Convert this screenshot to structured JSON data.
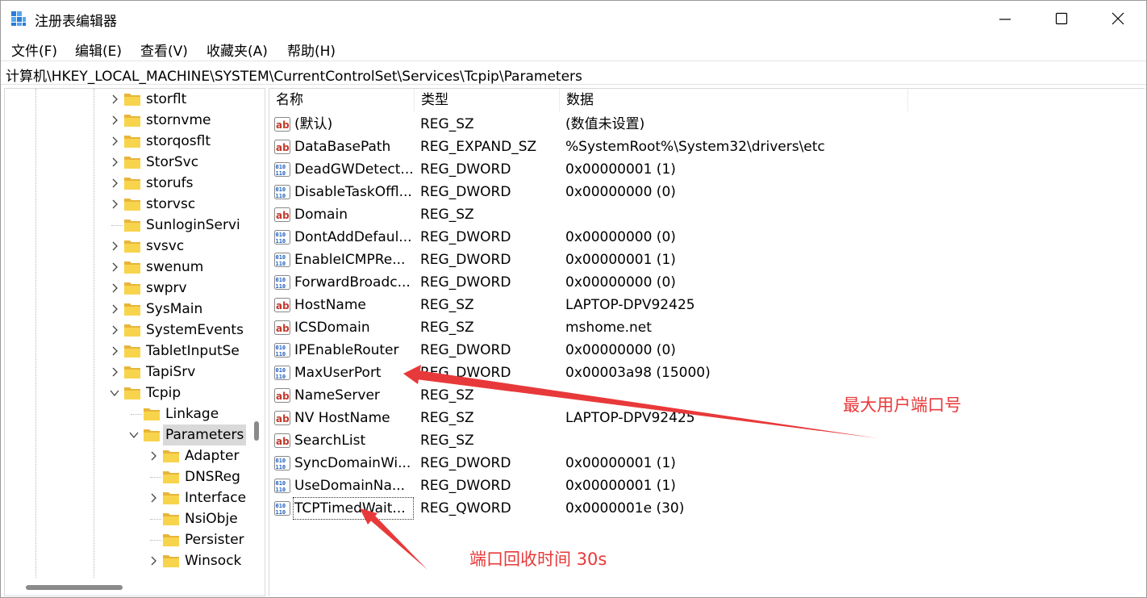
{
  "window": {
    "title": "注册表编辑器"
  },
  "menu": [
    {
      "label": "文件(F)"
    },
    {
      "label": "编辑(E)"
    },
    {
      "label": "查看(V)"
    },
    {
      "label": "收藏夹(A)"
    },
    {
      "label": "帮助(H)"
    }
  ],
  "address": "计算机\\HKEY_LOCAL_MACHINE\\SYSTEM\\CurrentControlSet\\Services\\Tcpip\\Parameters",
  "tree": {
    "items": [
      {
        "label": "storflt",
        "expander": "collapsed",
        "depth": 0
      },
      {
        "label": "stornvme",
        "expander": "collapsed",
        "depth": 0
      },
      {
        "label": "storqosflt",
        "expander": "collapsed",
        "depth": 0
      },
      {
        "label": "StorSvc",
        "expander": "collapsed",
        "depth": 0
      },
      {
        "label": "storufs",
        "expander": "collapsed",
        "depth": 0
      },
      {
        "label": "storvsc",
        "expander": "collapsed",
        "depth": 0
      },
      {
        "label": "SunloginServi",
        "expander": "none",
        "depth": 0
      },
      {
        "label": "svsvc",
        "expander": "collapsed",
        "depth": 0
      },
      {
        "label": "swenum",
        "expander": "collapsed",
        "depth": 0
      },
      {
        "label": "swprv",
        "expander": "collapsed",
        "depth": 0
      },
      {
        "label": "SysMain",
        "expander": "collapsed",
        "depth": 0
      },
      {
        "label": "SystemEvents",
        "expander": "collapsed",
        "depth": 0
      },
      {
        "label": "TabletInputSe",
        "expander": "collapsed",
        "depth": 0
      },
      {
        "label": "TapiSrv",
        "expander": "collapsed",
        "depth": 0
      },
      {
        "label": "Tcpip",
        "expander": "expanded",
        "depth": 0
      },
      {
        "label": "Linkage",
        "expander": "none",
        "depth": 1
      },
      {
        "label": "Parameters",
        "expander": "expanded",
        "depth": 1,
        "selected": true
      },
      {
        "label": "Adapter",
        "expander": "collapsed",
        "depth": 2
      },
      {
        "label": "DNSReg",
        "expander": "none",
        "depth": 2
      },
      {
        "label": "Interface",
        "expander": "collapsed",
        "depth": 2
      },
      {
        "label": "NsiObje",
        "expander": "none",
        "depth": 2
      },
      {
        "label": "Persister",
        "expander": "none",
        "depth": 2
      },
      {
        "label": "Winsock",
        "expander": "collapsed",
        "depth": 2
      }
    ]
  },
  "values": {
    "headers": {
      "name": "名称",
      "type": "类型",
      "data": "数据"
    },
    "rows": [
      {
        "icon": "string-value-icon",
        "name": "(默认)",
        "type": "REG_SZ",
        "data": "(数值未设置)"
      },
      {
        "icon": "string-value-icon",
        "name": "DataBasePath",
        "type": "REG_EXPAND_SZ",
        "data": "%SystemRoot%\\System32\\drivers\\etc"
      },
      {
        "icon": "binary-value-icon",
        "name": "DeadGWDetect...",
        "type": "REG_DWORD",
        "data": "0x00000001 (1)"
      },
      {
        "icon": "binary-value-icon",
        "name": "DisableTaskOffl...",
        "type": "REG_DWORD",
        "data": "0x00000000 (0)"
      },
      {
        "icon": "string-value-icon",
        "name": "Domain",
        "type": "REG_SZ",
        "data": ""
      },
      {
        "icon": "binary-value-icon",
        "name": "DontAddDefaul...",
        "type": "REG_DWORD",
        "data": "0x00000000 (0)"
      },
      {
        "icon": "binary-value-icon",
        "name": "EnableICMPRe...",
        "type": "REG_DWORD",
        "data": "0x00000001 (1)"
      },
      {
        "icon": "binary-value-icon",
        "name": "ForwardBroadc...",
        "type": "REG_DWORD",
        "data": "0x00000000 (0)"
      },
      {
        "icon": "string-value-icon",
        "name": "HostName",
        "type": "REG_SZ",
        "data": "LAPTOP-DPV92425"
      },
      {
        "icon": "string-value-icon",
        "name": "ICSDomain",
        "type": "REG_SZ",
        "data": "mshome.net"
      },
      {
        "icon": "binary-value-icon",
        "name": "IPEnableRouter",
        "type": "REG_DWORD",
        "data": "0x00000000 (0)"
      },
      {
        "icon": "binary-value-icon",
        "name": "MaxUserPort",
        "type": "REG_DWORD",
        "data": "0x00003a98 (15000)"
      },
      {
        "icon": "string-value-icon",
        "name": "NameServer",
        "type": "REG_SZ",
        "data": ""
      },
      {
        "icon": "string-value-icon",
        "name": "NV HostName",
        "type": "REG_SZ",
        "data": "LAPTOP-DPV92425"
      },
      {
        "icon": "string-value-icon",
        "name": "SearchList",
        "type": "REG_SZ",
        "data": ""
      },
      {
        "icon": "binary-value-icon",
        "name": "SyncDomainWi...",
        "type": "REG_DWORD",
        "data": "0x00000001 (1)"
      },
      {
        "icon": "binary-value-icon",
        "name": "UseDomainNa...",
        "type": "REG_DWORD",
        "data": "0x00000001 (1)"
      },
      {
        "icon": "binary-value-icon",
        "name": "TCPTimedWait...",
        "type": "REG_QWORD",
        "data": "0x0000001e (30)",
        "focused": true
      }
    ]
  },
  "annotations": [
    {
      "text": "最大用户端口号",
      "color": "#e8393a"
    },
    {
      "text": "端口回收时间 30s",
      "color": "#e8393a"
    }
  ]
}
